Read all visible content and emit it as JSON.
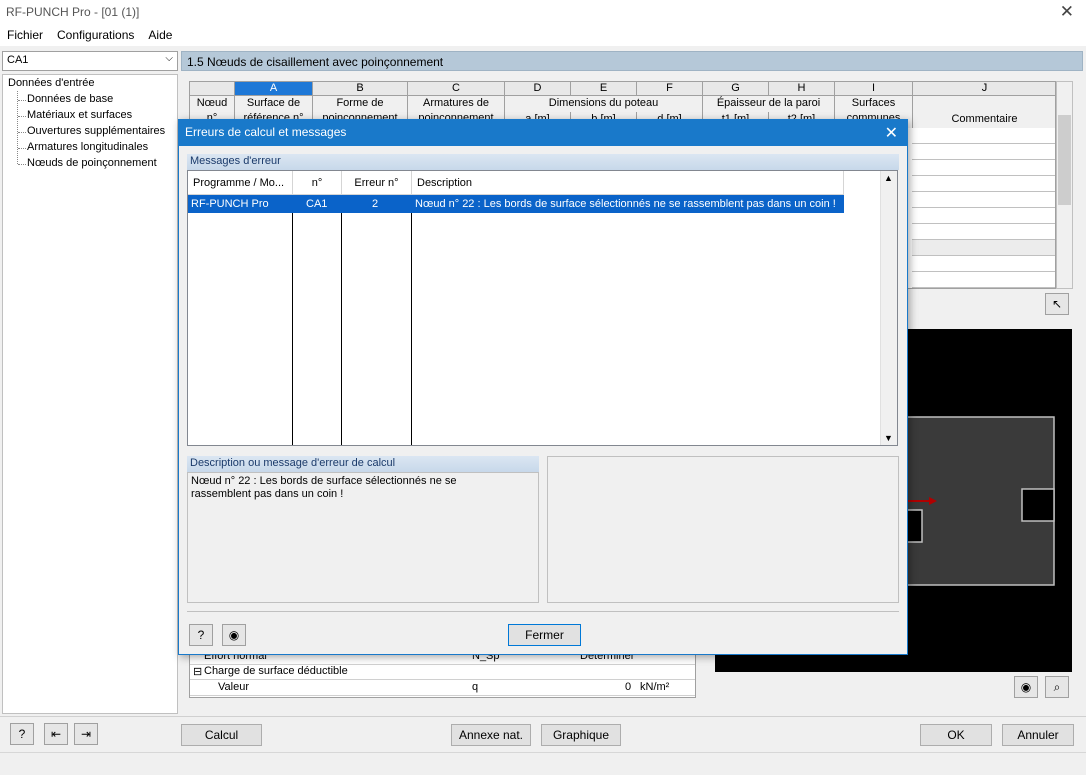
{
  "window": {
    "title": "RF-PUNCH Pro - [01 (1)]",
    "close": "✕"
  },
  "menu": {
    "items": [
      "Fichier",
      "Configurations",
      "Aide"
    ]
  },
  "left": {
    "case": "CA1",
    "tree_root": "Données d'entrée",
    "tree_items": [
      "Données de base",
      "Matériaux et surfaces",
      "Ouvertures supplémentaires",
      "Armatures longitudinales",
      "Nœuds de poinçonnement"
    ]
  },
  "main": {
    "header": "1.5  Nœuds de cisaillement avec poinçonnement",
    "columns": [
      "A",
      "B",
      "C",
      "D",
      "E",
      "F",
      "G",
      "H",
      "I",
      "J"
    ],
    "subheads": {
      "node": "Nœud\nn°",
      "a": "Surface de\nréférence n°",
      "b": "Forme de\npoinçonnement",
      "c": "Armatures de\npoinçonnement",
      "def": "Dimensions du poteau",
      "d_unit": "a [m]",
      "e_unit": "b [m]",
      "f_unit": "d [m]",
      "gh": "Épaisseur de la paroi",
      "g_unit": "t1 [m]",
      "h_unit": "t2 [m]",
      "i": "Surfaces\ncommunes",
      "j": "Commentaire"
    }
  },
  "bottom_table": {
    "row1_label": "Effort normal",
    "row1_sym": "N_Sp",
    "row1_val": "Déterminer",
    "row2_label": "Charge de surface déductible",
    "row3_label": "Valeur",
    "row3_sym": "q",
    "row3_val": "0",
    "row3_unit": "kN/m²"
  },
  "bottom_bar": {
    "calc": "Calcul",
    "annex": "Annexe nat.",
    "graph": "Graphique",
    "ok": "OK",
    "cancel": "Annuler"
  },
  "dialog": {
    "title": "Erreurs de calcul et messages",
    "group_messages": "Messages d'erreur",
    "headers": [
      "Programme / Mo...",
      "n°",
      "Erreur n°",
      "Description"
    ],
    "rows": [
      {
        "program": "RF-PUNCH Pro",
        "no": "CA1",
        "err": "2",
        "desc": "Nœud n° 22 : Les bords de surface sélectionnés ne se rassemblent pas dans un coin !"
      }
    ],
    "group_desc": "Description ou message d'erreur de calcul",
    "desc_text": "Nœud n° 22 : Les bords de surface sélectionnés ne se rassemblent pas dans un coin !",
    "close": "Fermer"
  },
  "colors": {
    "accent": "#1979ca",
    "selection": "#0a63c9",
    "header": "#b5c8d8"
  }
}
